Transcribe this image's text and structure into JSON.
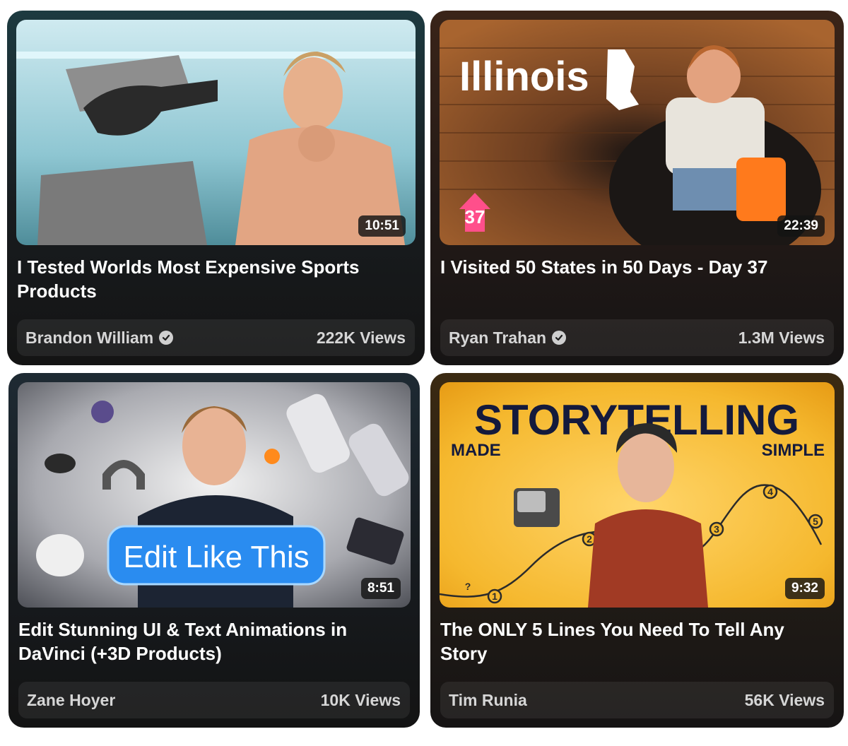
{
  "videos": [
    {
      "title": "I Tested Worlds Most Expensive Sports Products",
      "channel": "Brandon William",
      "verified": true,
      "views": "222K Views",
      "duration": "10:51",
      "accent": "#58c4e0"
    },
    {
      "title": "I Visited 50 States in 50 Days - Day 37",
      "channel": "Ryan Trahan",
      "verified": true,
      "views": "1.3M Views",
      "duration": "22:39",
      "thumb_text": "Illinois",
      "badge_number": "37",
      "accent": "#a45a2a"
    },
    {
      "title": "Edit Stunning UI & Text Animations in DaVinci (+3D Products)",
      "channel": "Zane Hoyer",
      "verified": false,
      "views": "10K Views",
      "duration": "8:51",
      "thumb_text": "Edit Like This",
      "accent": "#2a8cf0"
    },
    {
      "title": "The ONLY 5 Lines You Need To Tell Any Story",
      "channel": "Tim Runia",
      "verified": false,
      "views": "56K Views",
      "duration": "9:32",
      "thumb_text_main": "STORYTELLING",
      "thumb_text_left": "MADE",
      "thumb_text_right": "SIMPLE",
      "graph_labels": [
        "?",
        "1",
        "2",
        "3",
        "4",
        "5"
      ],
      "accent": "#f5b82e"
    }
  ]
}
